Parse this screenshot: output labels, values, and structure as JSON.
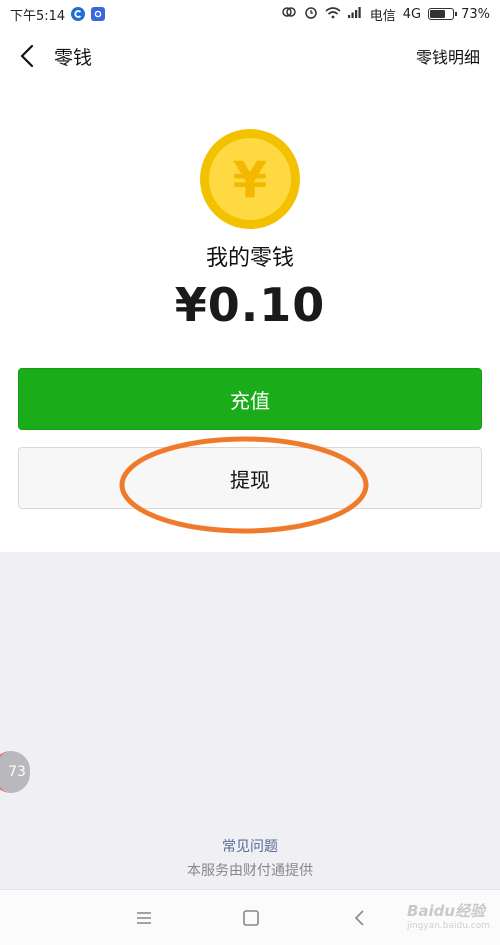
{
  "status_bar": {
    "time": "下午5:14",
    "carrier": "电信",
    "network": "4G",
    "battery": "73%",
    "battery_level": 0.73,
    "icons": [
      "c-app-icon",
      "app-icon",
      "sync-icon",
      "alarm-icon",
      "wifi-icon",
      "signal-icon",
      "battery-icon"
    ]
  },
  "nav": {
    "title": "零钱",
    "right_link": "零钱明细",
    "back_icon": "chevron-left-icon"
  },
  "wallet": {
    "coin_symbol": "¥",
    "label": "我的零钱",
    "amount": "¥0.10"
  },
  "actions": {
    "recharge_label": "充值",
    "withdraw_label": "提现"
  },
  "side_badge": {
    "count": "73"
  },
  "footer": {
    "faq_link": "常见问题",
    "provider_text": "本服务由财付通提供"
  },
  "system_nav": {
    "icons": [
      "menu-icon",
      "home-icon",
      "back-icon"
    ]
  },
  "watermark": {
    "brand": "Baidu经验",
    "url": "jingyan.baidu.com"
  },
  "colors": {
    "accent_green": "#1aad19",
    "coin_gold": "#f7c600",
    "link_blue": "#576b95",
    "annotation_orange": "#f07a2b",
    "background": "#efeff4"
  }
}
